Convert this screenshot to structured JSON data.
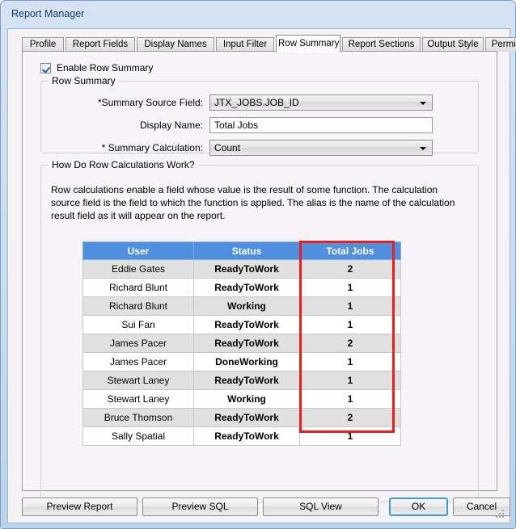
{
  "window": {
    "title": "Report Manager"
  },
  "tabs": [
    {
      "label": "Profile",
      "active": false
    },
    {
      "label": "Report Fields",
      "active": false
    },
    {
      "label": "Display Names",
      "active": false
    },
    {
      "label": "Input Filter",
      "active": false
    },
    {
      "label": "Row Summary",
      "active": true
    },
    {
      "label": "Report Sections",
      "active": false
    },
    {
      "label": "Output Style",
      "active": false
    },
    {
      "label": "Permissions",
      "active": false
    }
  ],
  "enable_row_summary": {
    "label": "Enable Row Summary",
    "checked": true
  },
  "row_summary_group": {
    "caption": "Row Summary",
    "fields": {
      "summary_source_field": {
        "label": "*Summary Source Field:",
        "value": "JTX_JOBS.JOB_ID"
      },
      "display_name": {
        "label": "Display Name:",
        "value": "Total Jobs",
        "placeholder": ""
      },
      "summary_calculation": {
        "label": "* Summary Calculation:",
        "value": "Count"
      }
    }
  },
  "help_group": {
    "caption": "How Do Row Calculations Work?",
    "text": "Row calculations enable a field whose value is the result of some function.  The calculation source field is the field to which the function is applied.  The alias is the name of the calculation result field as it will appear on the report."
  },
  "example_table": {
    "columns": [
      "User",
      "Status",
      "Total Jobs"
    ],
    "highlight_column": "Total Jobs",
    "highlight_color": "#ee1c1c",
    "header_color": "#4f8fe0",
    "rows": [
      {
        "user": "Eddie Gates",
        "status": "ReadyToWork",
        "total": "2"
      },
      {
        "user": "Richard Blunt",
        "status": "ReadyToWork",
        "total": "1"
      },
      {
        "user": "Richard Blunt",
        "status": "Working",
        "total": "1"
      },
      {
        "user": "Sui Fan",
        "status": "ReadyToWork",
        "total": "1"
      },
      {
        "user": "James Pacer",
        "status": "ReadyToWork",
        "total": "2"
      },
      {
        "user": "James Pacer",
        "status": "DoneWorking",
        "total": "1"
      },
      {
        "user": "Stewart Laney",
        "status": "ReadyToWork",
        "total": "1"
      },
      {
        "user": "Stewart Laney",
        "status": "Working",
        "total": "1"
      },
      {
        "user": "Bruce Thomson",
        "status": "ReadyToWork",
        "total": "2"
      },
      {
        "user": "Sally Spatial",
        "status": "ReadyToWork",
        "total": "1"
      }
    ]
  },
  "buttons": {
    "preview_report": "Preview Report",
    "preview_sql": "Preview SQL",
    "sql_view": "SQL View",
    "ok": "OK",
    "cancel": "Cancel"
  }
}
